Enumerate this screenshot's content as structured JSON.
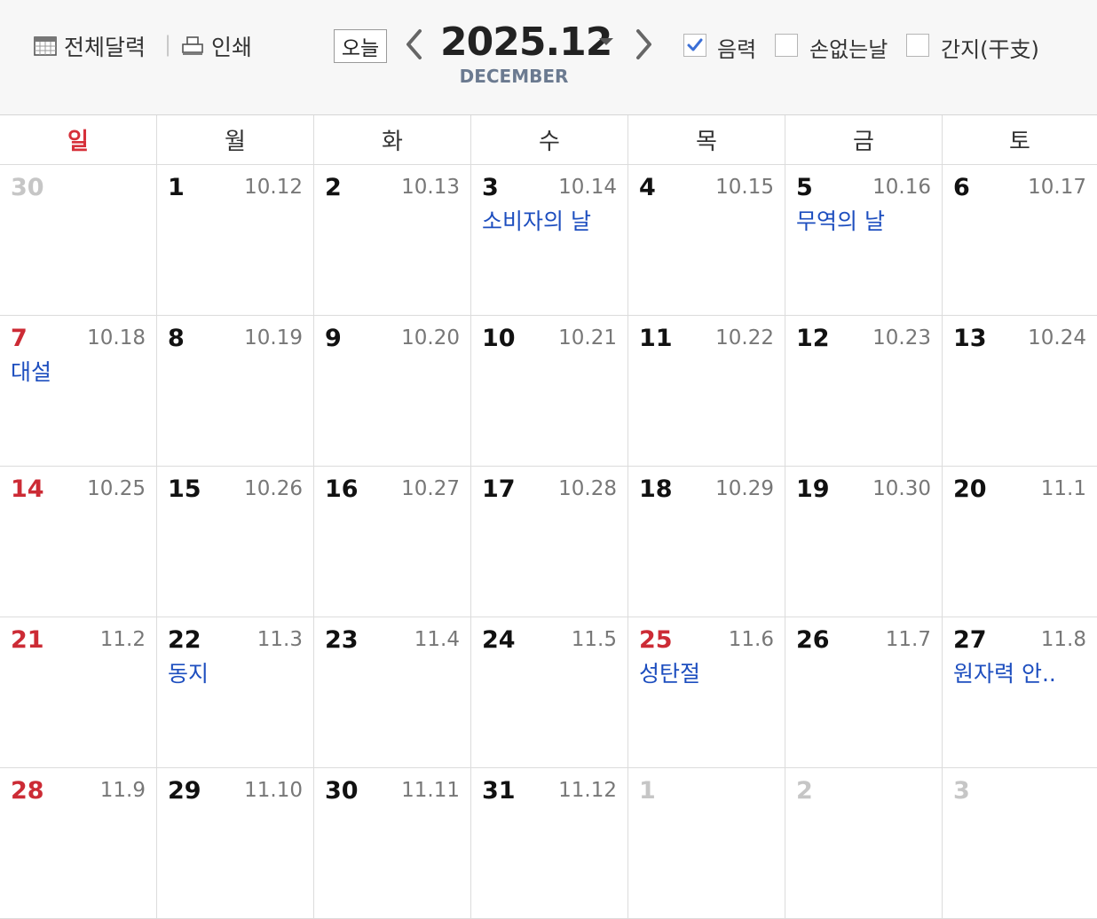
{
  "toolbar": {
    "full_calendar_label": "전체달력",
    "print_label": "인쇄",
    "separator": "|",
    "today_label": "오늘",
    "month_title": "2025.12",
    "month_subtitle": "DECEMBER",
    "options": [
      {
        "label": "음력",
        "checked": true
      },
      {
        "label": "손없는날",
        "checked": false
      },
      {
        "label": "간지(干支)",
        "checked": false
      }
    ]
  },
  "weekdays": [
    "일",
    "월",
    "화",
    "수",
    "목",
    "금",
    "토"
  ],
  "weeks": [
    [
      {
        "day": "30",
        "lunar": "",
        "event": "",
        "type": "other"
      },
      {
        "day": "1",
        "lunar": "10.12",
        "event": "",
        "type": "normal"
      },
      {
        "day": "2",
        "lunar": "10.13",
        "event": "",
        "type": "normal"
      },
      {
        "day": "3",
        "lunar": "10.14",
        "event": "소비자의 날",
        "type": "normal"
      },
      {
        "day": "4",
        "lunar": "10.15",
        "event": "",
        "type": "normal"
      },
      {
        "day": "5",
        "lunar": "10.16",
        "event": "무역의 날",
        "type": "normal"
      },
      {
        "day": "6",
        "lunar": "10.17",
        "event": "",
        "type": "normal"
      }
    ],
    [
      {
        "day": "7",
        "lunar": "10.18",
        "event": "대설",
        "type": "sun"
      },
      {
        "day": "8",
        "lunar": "10.19",
        "event": "",
        "type": "normal"
      },
      {
        "day": "9",
        "lunar": "10.20",
        "event": "",
        "type": "normal"
      },
      {
        "day": "10",
        "lunar": "10.21",
        "event": "",
        "type": "normal"
      },
      {
        "day": "11",
        "lunar": "10.22",
        "event": "",
        "type": "normal"
      },
      {
        "day": "12",
        "lunar": "10.23",
        "event": "",
        "type": "normal"
      },
      {
        "day": "13",
        "lunar": "10.24",
        "event": "",
        "type": "normal"
      }
    ],
    [
      {
        "day": "14",
        "lunar": "10.25",
        "event": "",
        "type": "sun"
      },
      {
        "day": "15",
        "lunar": "10.26",
        "event": "",
        "type": "normal"
      },
      {
        "day": "16",
        "lunar": "10.27",
        "event": "",
        "type": "normal"
      },
      {
        "day": "17",
        "lunar": "10.28",
        "event": "",
        "type": "normal"
      },
      {
        "day": "18",
        "lunar": "10.29",
        "event": "",
        "type": "normal"
      },
      {
        "day": "19",
        "lunar": "10.30",
        "event": "",
        "type": "normal"
      },
      {
        "day": "20",
        "lunar": "11.1",
        "event": "",
        "type": "normal"
      }
    ],
    [
      {
        "day": "21",
        "lunar": "11.2",
        "event": "",
        "type": "sun"
      },
      {
        "day": "22",
        "lunar": "11.3",
        "event": "동지",
        "type": "normal"
      },
      {
        "day": "23",
        "lunar": "11.4",
        "event": "",
        "type": "normal"
      },
      {
        "day": "24",
        "lunar": "11.5",
        "event": "",
        "type": "normal"
      },
      {
        "day": "25",
        "lunar": "11.6",
        "event": "성탄절",
        "type": "hol"
      },
      {
        "day": "26",
        "lunar": "11.7",
        "event": "",
        "type": "normal"
      },
      {
        "day": "27",
        "lunar": "11.8",
        "event": "원자력 안..",
        "type": "normal"
      }
    ],
    [
      {
        "day": "28",
        "lunar": "11.9",
        "event": "",
        "type": "sun"
      },
      {
        "day": "29",
        "lunar": "11.10",
        "event": "",
        "type": "normal"
      },
      {
        "day": "30",
        "lunar": "11.11",
        "event": "",
        "type": "normal"
      },
      {
        "day": "31",
        "lunar": "11.12",
        "event": "",
        "type": "normal"
      },
      {
        "day": "1",
        "lunar": "",
        "event": "",
        "type": "other"
      },
      {
        "day": "2",
        "lunar": "",
        "event": "",
        "type": "other"
      },
      {
        "day": "3",
        "lunar": "",
        "event": "",
        "type": "other"
      }
    ]
  ],
  "colors": {
    "sunday": "#cc2b35",
    "event": "#1d4ebf",
    "lunar": "#777777",
    "other_month": "#c6c6c6",
    "checkbox_check": "#3b6fd6"
  },
  "icons": {
    "full_calendar": "calendar-grid-icon",
    "print": "printer-icon",
    "prev": "chevron-left-icon",
    "next": "chevron-right-icon",
    "month_dropdown": "caret-down-icon"
  }
}
